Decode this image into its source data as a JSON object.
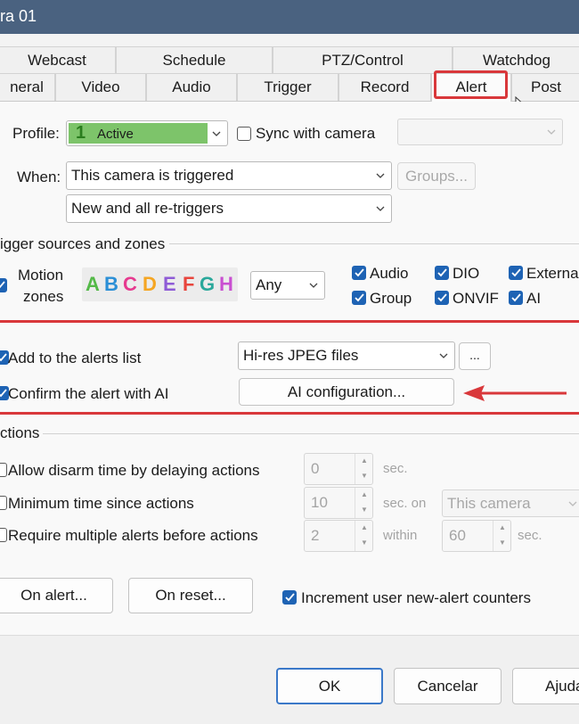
{
  "window": {
    "title": "ra 01"
  },
  "tabs_row1": [
    "Webcast",
    "Schedule",
    "PTZ/Control",
    "Watchdog"
  ],
  "tabs_row2": [
    "neral",
    "Video",
    "Audio",
    "Trigger",
    "Record",
    "Alert",
    "Post"
  ],
  "profile": {
    "label": "Profile:",
    "number": "1",
    "value": "Active",
    "sync_label": "Sync with camera"
  },
  "when": {
    "label": "When:",
    "value": "This camera is triggered",
    "groups_button": "Groups...",
    "retrigger_value": "New and all re-triggers"
  },
  "trigger_sources": {
    "heading": "igger sources and zones",
    "motion_label_1": "Motion",
    "motion_label_2": "zones",
    "zones": [
      "A",
      "B",
      "C",
      "D",
      "E",
      "F",
      "G",
      "H"
    ],
    "zone_colors": [
      "#54b948",
      "#2b8fd6",
      "#e63a8f",
      "#f5a623",
      "#8e5bd6",
      "#e8453c",
      "#2aa89b",
      "#c94fd1"
    ],
    "zone_mode": "Any",
    "checkboxes": [
      "Audio",
      "DIO",
      "External",
      "Group",
      "ONVIF",
      "AI"
    ]
  },
  "alert": {
    "add_to_list_label": "Add to the alerts list",
    "list_format": "Hi-res JPEG files",
    "more_button": "...",
    "confirm_ai_label": "Confirm the alert with AI",
    "ai_config_button": "AI configuration..."
  },
  "actions": {
    "heading": "ctions",
    "disarm_label": "Allow disarm time by delaying actions",
    "disarm_value": "0",
    "disarm_unit": "sec.",
    "min_time_label": "Minimum time since actions",
    "min_time_value": "10",
    "min_time_unit": "sec. on",
    "min_time_target": "This camera",
    "multi_label": "Require multiple alerts before actions",
    "multi_value": "2",
    "multi_within": "within",
    "multi_seconds": "60",
    "multi_unit": "sec.",
    "on_alert_button": "On alert...",
    "on_reset_button": "On reset...",
    "increment_label": "Increment user new-alert counters"
  },
  "footer": {
    "ok": "OK",
    "cancel": "Cancelar",
    "help": "Ajuda"
  },
  "colors": {
    "accent": "#1e63b4",
    "annotation": "#d9383b",
    "profile_bg": "#7dc46a"
  }
}
